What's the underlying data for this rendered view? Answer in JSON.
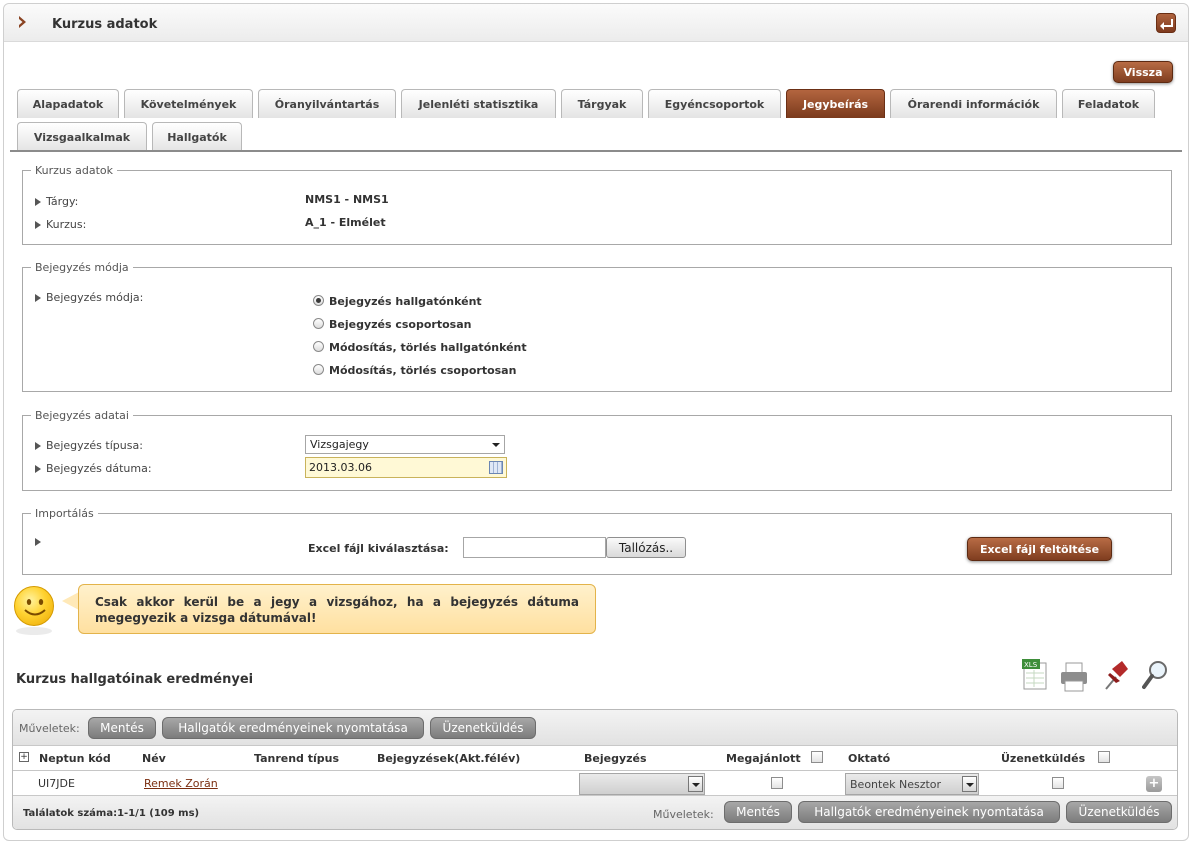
{
  "window": {
    "title": "Kurzus adatok"
  },
  "back_button": "Vissza",
  "tabs": [
    {
      "label": "Alapadatok"
    },
    {
      "label": "Követelmények"
    },
    {
      "label": "Óranyilvántartás"
    },
    {
      "label": "Jelenléti statisztika"
    },
    {
      "label": "Tárgyak"
    },
    {
      "label": "Egyéncsoportok"
    },
    {
      "label": "Jegybeírás",
      "active": true
    },
    {
      "label": "Órarendi információk"
    },
    {
      "label": "Feladatok"
    },
    {
      "label": "Vizsgaalkalmak"
    },
    {
      "label": "Hallgatók"
    }
  ],
  "course_box": {
    "legend": "Kurzus adatok",
    "subject_label": "Tárgy:",
    "subject_value": "NMS1 - NMS1",
    "course_label": "Kurzus:",
    "course_value": "A_1 - Elmélet"
  },
  "entry_mode_box": {
    "legend": "Bejegyzés módja",
    "label": "Bejegyzés módja:",
    "options": [
      {
        "label": "Bejegyzés hallgatónként",
        "selected": true
      },
      {
        "label": "Bejegyzés csoportosan",
        "selected": false
      },
      {
        "label": "Módosítás, törlés hallgatónként",
        "selected": false
      },
      {
        "label": "Módosítás, törlés csoportosan",
        "selected": false
      }
    ]
  },
  "entry_data_box": {
    "legend": "Bejegyzés adatai",
    "type_label": "Bejegyzés típusa:",
    "type_value": "Vizsgajegy",
    "date_label": "Bejegyzés dátuma:",
    "date_value": "2013.03.06"
  },
  "import_box": {
    "legend": "Importálás",
    "file_label": "Excel fájl kiválasztása:",
    "browse_button": "Tallózás..",
    "upload_button": "Excel fájl feltöltése"
  },
  "hint": "Csak akkor kerül be a jegy a vizsgához, ha a bejegyzés dátuma megegyezik a vizsga dátumával!",
  "results_section": {
    "title": "Kurzus hallgatóinak eredményei",
    "toolbar": {
      "ops_label": "Műveletek:",
      "save": "Mentés",
      "print": "Hallgatók eredményeinek nyomtatása",
      "message": "Üzenetküldés"
    },
    "columns": [
      "Neptun kód",
      "Név",
      "Tanrend típus",
      "Bejegyzések(Akt.félév)",
      "Bejegyzés",
      "Megajánlott",
      "Oktató",
      "Üzenetküldés"
    ],
    "rows": [
      {
        "neptun": "UI7JDE",
        "name": "Remek Zorán",
        "teacher": "Beontek Nesztor"
      }
    ],
    "footer": {
      "results": "Találatok száma:1-1/1 (109 ms)"
    },
    "tools": [
      "excel-export-icon",
      "print-icon",
      "pin-icon",
      "search-icon"
    ]
  },
  "colors": {
    "accent": "#8a4322",
    "bubble": "#ffe6ad"
  }
}
